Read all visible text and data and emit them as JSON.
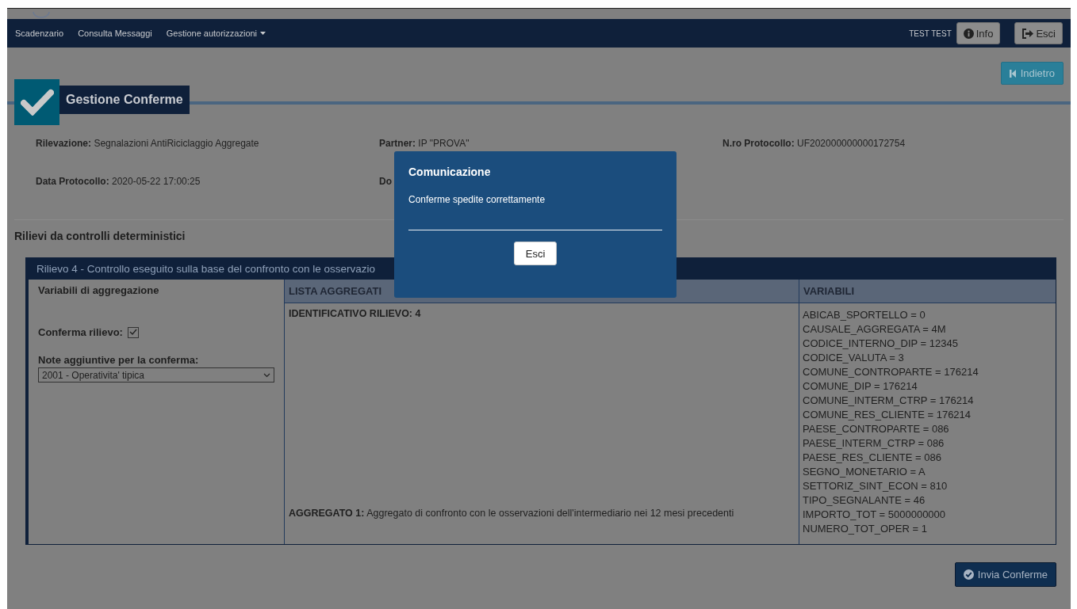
{
  "navbar": {
    "links": [
      {
        "label": "Scadenzario",
        "dropdown": false
      },
      {
        "label": "Consulta Messaggi",
        "dropdown": false
      },
      {
        "label": "Gestione autorizzazioni",
        "dropdown": true
      }
    ],
    "user": "TEST TEST",
    "buttons": [
      {
        "kind": "info",
        "label": "Info"
      },
      {
        "kind": "logout",
        "label": "Esci"
      }
    ]
  },
  "back_button": {
    "label": "Indietro"
  },
  "page_title": "Gestione Conferme",
  "info_fields": [
    {
      "label": "Rilevazione:",
      "value": "Segnalazioni AntiRiciclaggio Aggregate",
      "kind": "text"
    },
    {
      "label": "Partner:",
      "value": "IP \"PROVA\"",
      "kind": "text"
    },
    {
      "label": "N.ro Protocollo:",
      "value": "UF202000000000172754",
      "kind": "text"
    },
    {
      "label": "Data Protocollo:",
      "value": "2020-05-22 17:00:25",
      "kind": "text"
    },
    {
      "label": "Do",
      "kind": "cut"
    }
  ],
  "section_title": "Rilievi da controlli deterministici",
  "rilievo": {
    "title": "Rilievo 4 - Controllo eseguito sulla base del confronto con le osservazio",
    "columns": [
      "Variabili di aggregazione",
      "LISTA AGGREGATI",
      "VARIABILI"
    ],
    "confirm_label": "Conferma rilievo:",
    "confirm_checked": true,
    "notes_label": "Note aggiuntive per la conferma:",
    "notes_value": "2001 - Operativita' tipica",
    "rows": [
      {
        "kind": "heading",
        "text": "IDENTIFICATIVO RILIEVO: 4",
        "variables": [
          "ABICAB_SPORTELLO = 0",
          "CAUSALE_AGGREGATA = 4M",
          "CODICE_INTERNO_DIP = 12345",
          "CODICE_VALUTA = 3",
          "COMUNE_CONTROPARTE = 176214",
          "COMUNE_DIP = 176214",
          "COMUNE_INTERM_CTRP = 176214",
          "COMUNE_RES_CLIENTE = 176214",
          "PAESE_CONTROPARTE = 086",
          "PAESE_INTERM_CTRP = 086",
          "PAESE_RES_CLIENTE = 086",
          "SEGNO_MONETARIO = A",
          "SETTORIZ_SINT_ECON = 810",
          "TIPO_SEGNALANTE = 46"
        ]
      },
      {
        "kind": "aggregate",
        "text": "**AGGREGATO 1:** Aggregato di confronto con le osservazioni dell'intermediario nei 12 mesi precedenti",
        "variables": [
          "IMPORTO_TOT = 5000000000",
          "NUMERO_TOT_OPER = 1"
        ]
      }
    ]
  },
  "submit_button": {
    "label": "Invia Conferme"
  },
  "modal": {
    "title": "Comunicazione",
    "message": "Conferme spedite correttamente",
    "button": "Esci"
  }
}
